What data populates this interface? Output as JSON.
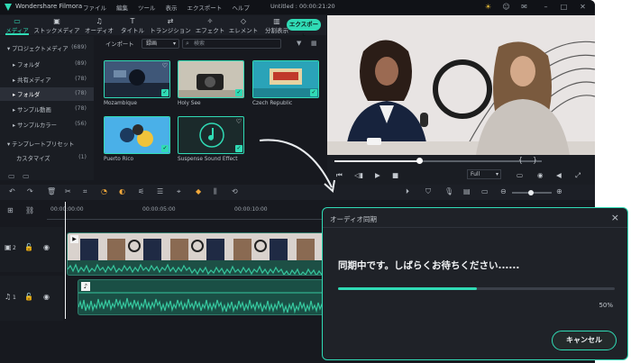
{
  "titlebar": {
    "app_name": "Wondershare Filmora",
    "menus": [
      "ファイル",
      "編集",
      "ツール",
      "表示",
      "エクスポート",
      "ヘルプ"
    ],
    "project_title": "Untitled : 00:00:21:20"
  },
  "tabs": [
    {
      "label": "メディア",
      "icon": "folder-icon"
    },
    {
      "label": "ストックメディア",
      "icon": "stock-icon"
    },
    {
      "label": "オーディオ",
      "icon": "music-note-icon"
    },
    {
      "label": "タイトル",
      "icon": "title-icon"
    },
    {
      "label": "トランジション",
      "icon": "transition-icon"
    },
    {
      "label": "エフェクト",
      "icon": "effects-icon"
    },
    {
      "label": "エレメント",
      "icon": "elements-icon"
    },
    {
      "label": "分割表示",
      "icon": "split-screen-icon"
    }
  ],
  "export_label": "エクスポート",
  "sidebar": {
    "items": [
      {
        "label": "▾ プロジェクトメディア",
        "count": "(689)"
      },
      {
        "label": "▸ フォルダ",
        "count": "(89)"
      },
      {
        "label": "▸ 共有メディア",
        "count": "(78)"
      },
      {
        "label": "▸ フォルダ",
        "count": "(78)"
      },
      {
        "label": "▸ サンプル動画",
        "count": "(78)"
      },
      {
        "label": "▸ サンプルカラー",
        "count": "(56)"
      },
      {
        "label": "▾ テンプレートプリセット",
        "count": ""
      },
      {
        "label": "カスタマイズ",
        "count": "(1)"
      }
    ]
  },
  "media": {
    "import_label": "インポート",
    "record_label": "録画",
    "search_placeholder": "検索",
    "thumbs": [
      {
        "label": "Mozambique"
      },
      {
        "label": "Holy See"
      },
      {
        "label": "Czech Republic"
      },
      {
        "label": "Puerto Rico"
      },
      {
        "label": "Suspense Sound Effect"
      }
    ]
  },
  "preview": {
    "zoom": "Full",
    "progress": 0.41
  },
  "timeline": {
    "times": [
      "00:00:00:00",
      "00:00:05:00",
      "00:00:10:00"
    ],
    "video_track": "2",
    "audio_track": "1"
  },
  "dialog": {
    "title": "オーディオ同期",
    "message": "同期中です。しばらくお待ちください......",
    "percent_text": "50%",
    "progress": 0.5,
    "cancel_label": "キャンセル"
  },
  "colors": {
    "accent": "#30dbb5",
    "background": "#17191f"
  }
}
